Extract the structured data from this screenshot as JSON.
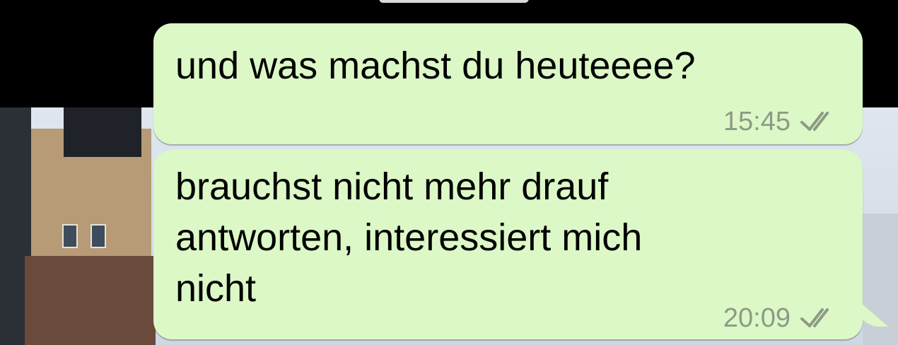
{
  "chat": {
    "messages": [
      {
        "text": "und was machst du heuteeee?",
        "time": "15:45",
        "status_icon": "double-check-icon"
      },
      {
        "text": "brauchst nicht mehr drauf\nantworten, interessiert mich\nnicht",
        "time": "20:09",
        "status_icon": "double-check-icon"
      }
    ],
    "colors": {
      "outgoing_bubble": "#dcf8c6",
      "meta_text": "#8d9a85"
    }
  }
}
